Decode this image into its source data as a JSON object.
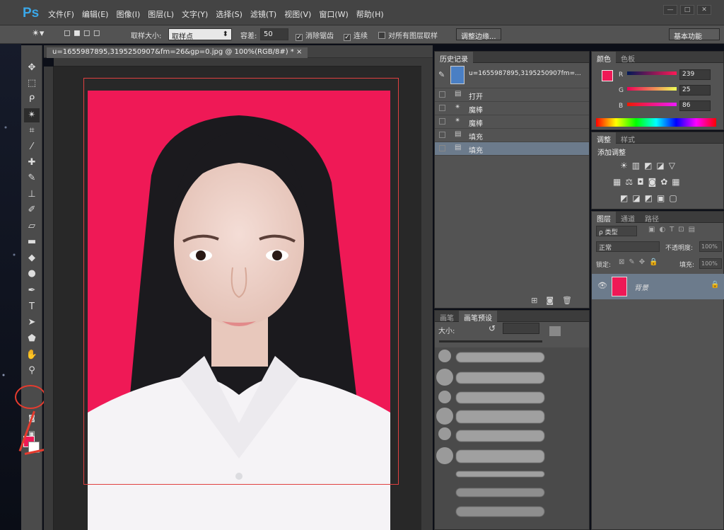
{
  "app": {
    "logo": "Ps"
  },
  "menu": [
    "文件(F)",
    "编辑(E)",
    "图像(I)",
    "图层(L)",
    "文字(Y)",
    "选择(S)",
    "滤镜(T)",
    "视图(V)",
    "窗口(W)",
    "帮助(H)"
  ],
  "window_buttons": [
    "—",
    "□",
    "✕"
  ],
  "options": {
    "sample_size_label": "取样大小:",
    "sample_size_value": "取样点",
    "tolerance_label": "容差:",
    "tolerance_value": "50",
    "antialias_label": "消除锯齿",
    "contiguous_label": "连续",
    "all_layers_label": "对所有图层取样",
    "refine_edge_label": "调整边缘...",
    "workspace": "基本功能"
  },
  "document": {
    "tab_title": "u=1655987895,3195250907&fm=26&gp=0.jpg @ 100%(RGB/8#) *",
    "close": "×"
  },
  "history": {
    "tab_history": "历史记录",
    "snapshot_label": "u=1655987895,3195250907fm=...",
    "items": [
      "打开",
      "魔棒",
      "魔棒",
      "填充",
      "填充"
    ]
  },
  "color_panel": {
    "tab_color": "颜色",
    "tab_swatches": "色板",
    "r_label": "R",
    "g_label": "G",
    "b_label": "B",
    "r": "239",
    "g": "25",
    "b": "86",
    "fg_color": "#ef1956"
  },
  "adjust": {
    "tab_adjust": "调整",
    "tab_styles": "样式",
    "title": "添加调整"
  },
  "layers": {
    "tab_layers": "图层",
    "tab_channels": "通道",
    "tab_paths": "路径",
    "kind": "ρ 类型",
    "blend": "正常",
    "opacity_label": "不透明度:",
    "opacity": "100%",
    "lock_label": "锁定:",
    "fill_label": "填充:",
    "fill": "100%",
    "layer_name": "背景"
  },
  "brush": {
    "tab_brush": "画笔",
    "tab_presets": "画笔预设",
    "size_label": "大小:"
  }
}
